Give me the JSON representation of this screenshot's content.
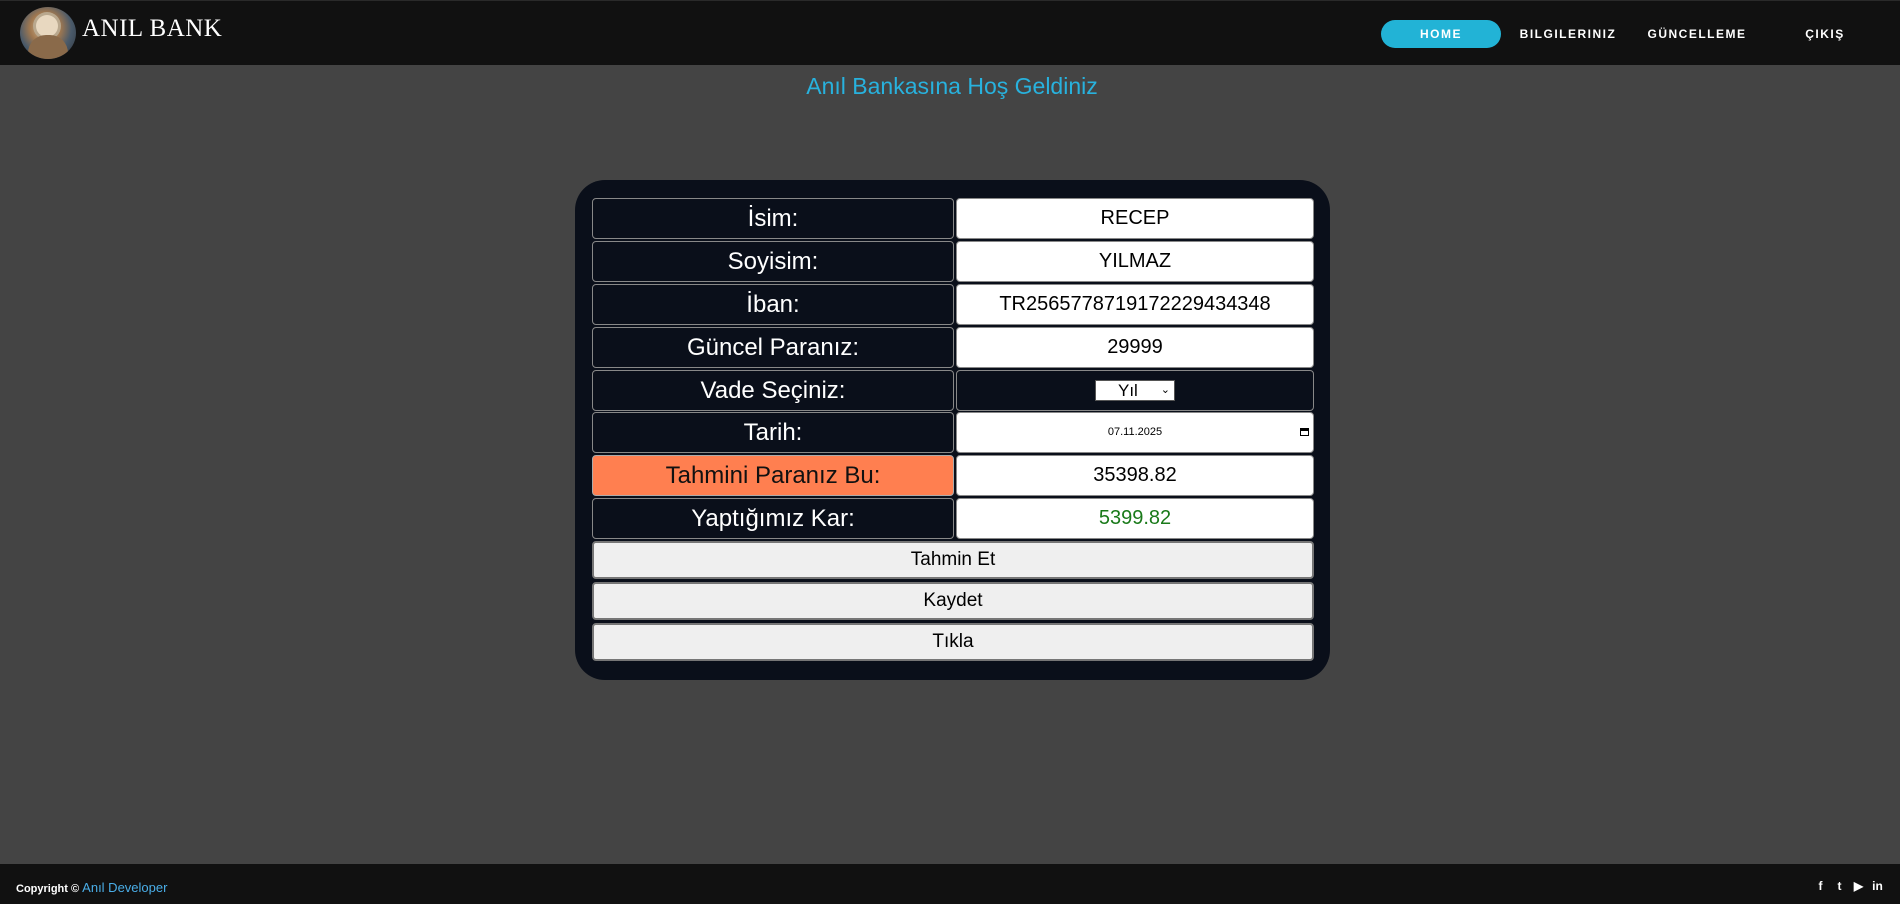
{
  "nav": {
    "brand": "ANIL BANK",
    "items": [
      "HOME",
      "BILGILERINIZ",
      "GÜNCELLEME",
      "ÇIKIŞ"
    ],
    "active": "HOME",
    "accent_color": "#22b3d6"
  },
  "welcome": "Anıl Bankasına Hoş Geldiniz",
  "form": {
    "rows": [
      {
        "label": "İsim:",
        "value": "RECEP"
      },
      {
        "label": "Soyisim:",
        "value": "YILMAZ"
      },
      {
        "label": "İban:",
        "value": "TR256577871917222943434​8"
      },
      {
        "label": "Güncel Paranız:",
        "value": "29999"
      },
      {
        "label": "Vade Seçiniz:",
        "value": "Yıl"
      },
      {
        "label": "Tarih:",
        "value": "07.11.2025"
      },
      {
        "label": "Tahmini Paranız Bu:",
        "value": "35398.82"
      },
      {
        "label": "Yaptığımız Kar:",
        "value": "5399.82"
      }
    ],
    "buttons": [
      "Tahmin Et",
      "Kaydet",
      "Tıkla"
    ]
  },
  "footer": {
    "copyright": "Copyright ©",
    "developer": "Anıl Developer",
    "social_icons": [
      "facebook-icon",
      "twitter-icon",
      "youtube-icon",
      "linkedin-icon"
    ]
  },
  "colors": {
    "background": "#444444",
    "panel": "#0a0f1a",
    "highlight": "#ff7f50",
    "profit": "#1a7a1a",
    "title": "#28b2de"
  }
}
